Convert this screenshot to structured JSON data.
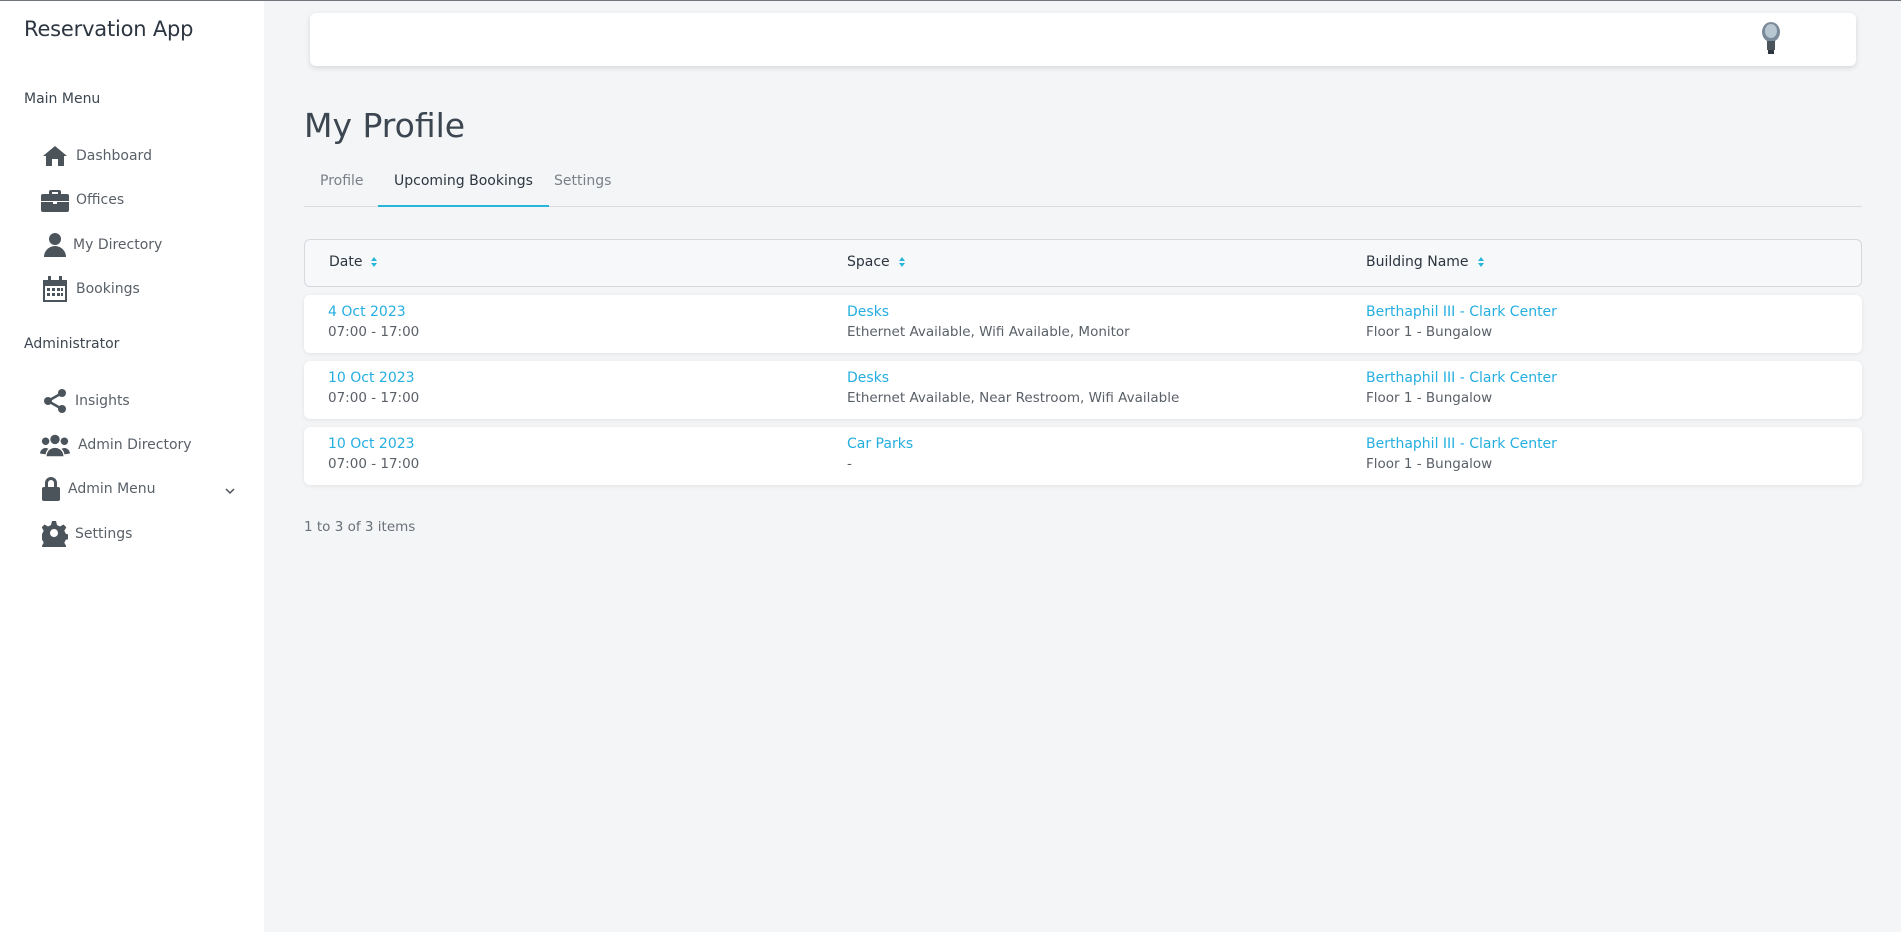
{
  "app": {
    "title": "Reservation App"
  },
  "sidebar": {
    "main_menu_label": "Main Menu",
    "main_items": [
      {
        "label": "Dashboard",
        "icon": "home-icon"
      },
      {
        "label": "Offices",
        "icon": "briefcase-icon"
      },
      {
        "label": "My Directory",
        "icon": "user-icon"
      },
      {
        "label": "Bookings",
        "icon": "calendar-icon"
      }
    ],
    "admin_label": "Administrator",
    "admin_items": [
      {
        "label": "Insights",
        "icon": "share-icon"
      },
      {
        "label": "Admin Directory",
        "icon": "users-icon"
      },
      {
        "label": "Admin Menu",
        "icon": "lock-icon"
      },
      {
        "label": "Settings",
        "icon": "gear-icon"
      }
    ]
  },
  "page": {
    "title": "My Profile"
  },
  "tabs": [
    {
      "label": "Profile",
      "active": false
    },
    {
      "label": "Upcoming Bookings",
      "active": true
    },
    {
      "label": "Settings",
      "active": false
    }
  ],
  "table": {
    "columns": [
      "Date",
      "Space",
      "Building Name"
    ],
    "rows": [
      {
        "date": "4 Oct 2023",
        "time": "07:00 - 17:00",
        "space": "Desks",
        "features": "Ethernet Available, Wifi Available, Monitor",
        "building": "Berthaphil III - Clark Center",
        "floor": "Floor 1 - Bungalow"
      },
      {
        "date": "10 Oct 2023",
        "time": "07:00 - 17:00",
        "space": "Desks",
        "features": "Ethernet Available, Near Restroom, Wifi Available",
        "building": "Berthaphil III - Clark Center",
        "floor": "Floor 1 - Bungalow"
      },
      {
        "date": "10 Oct 2023",
        "time": "07:00 - 17:00",
        "space": "Car Parks",
        "features": "-",
        "building": "Berthaphil III - Clark Center",
        "floor": "Floor 1 - Bungalow"
      }
    ],
    "pager_info": "1 to 3 of 3 items"
  },
  "colors": {
    "accent": "#27b6d9",
    "link": "#25aee0",
    "background": "#f3f5f7"
  }
}
